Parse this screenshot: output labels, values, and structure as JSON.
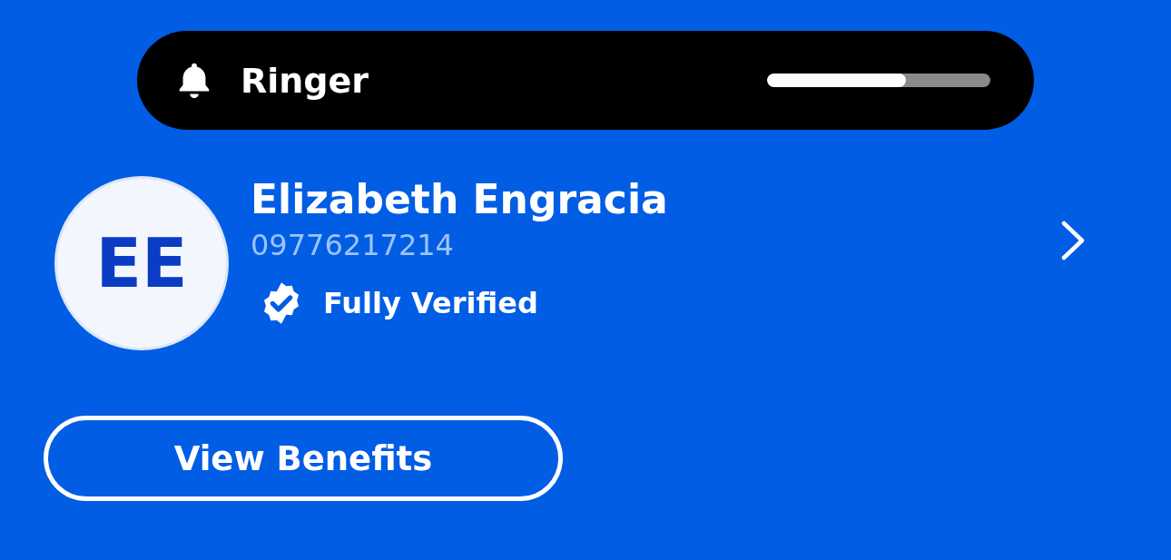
{
  "ringer": {
    "label": "Ringer",
    "level": 0.62
  },
  "profile": {
    "initials": "EE",
    "name": "Elizabeth Engracia",
    "phone": "09776217214",
    "verified": true,
    "status": "Fully Verified"
  },
  "button": {
    "label": "View Benefits"
  }
}
